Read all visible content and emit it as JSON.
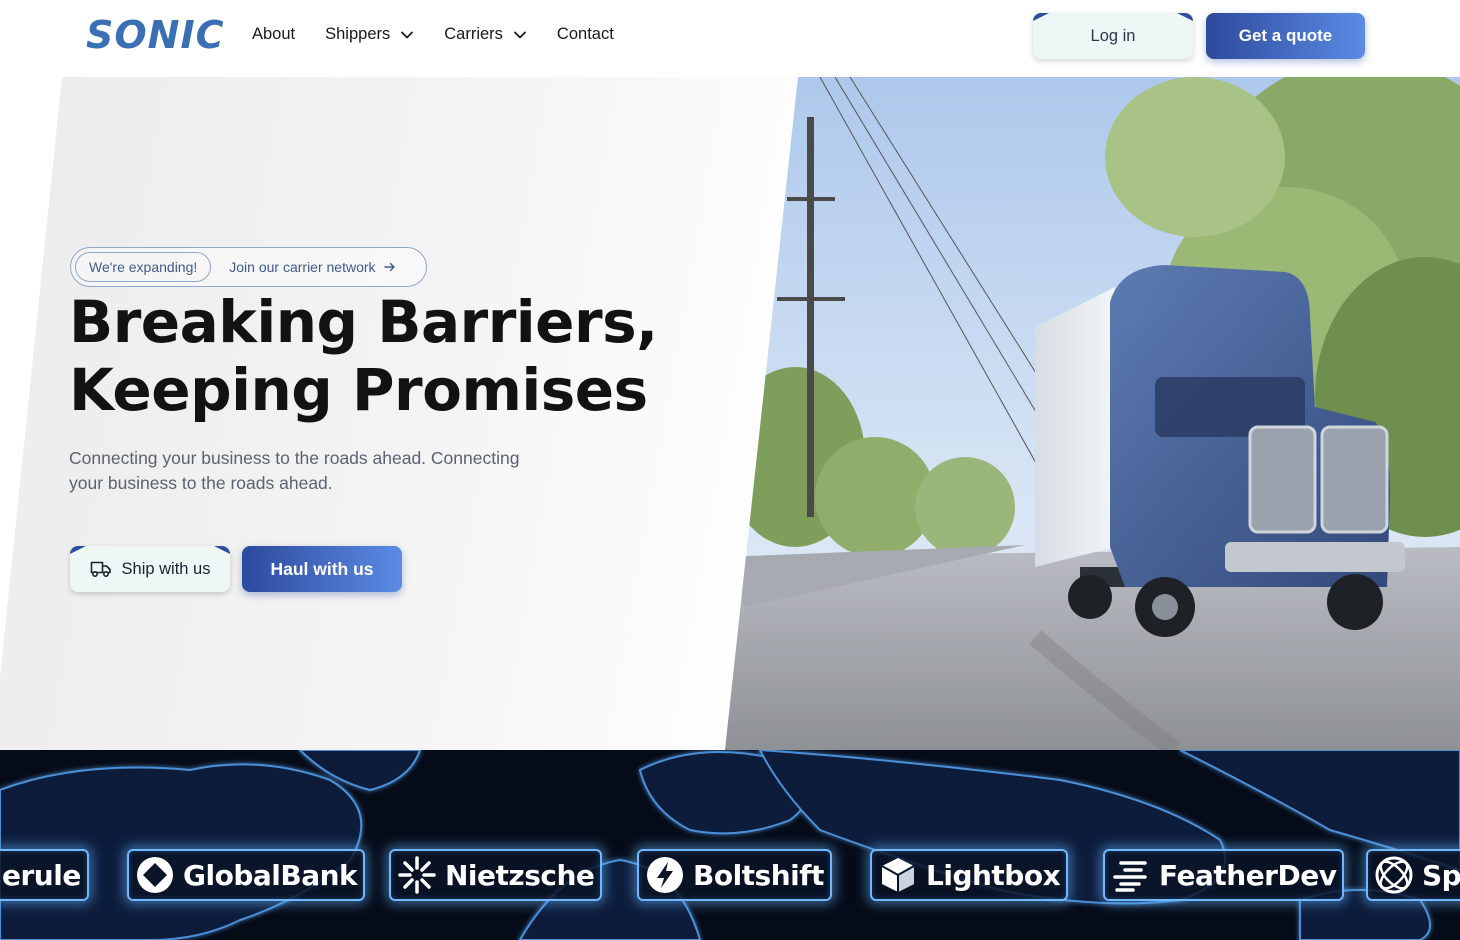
{
  "brand": {
    "name": "SONIC",
    "color": "#3b6fb3"
  },
  "nav": {
    "links": [
      {
        "label": "About"
      },
      {
        "label": "Shippers"
      },
      {
        "label": "Carriers"
      },
      {
        "label": "Contact"
      }
    ],
    "login_label": "Log in",
    "quote_label": "Get a quote"
  },
  "hero": {
    "badge": "We're expanding!",
    "badge_link": "Join our carrier network",
    "headline_line1": "Breaking Barriers,",
    "headline_line2": "Keeping Promises",
    "subtext": "Connecting your business to the roads ahead. Connecting your business to the roads ahead.",
    "ship_label": "Ship with us",
    "haul_label": "Haul with us"
  },
  "partners": [
    {
      "name": "erule",
      "icon": "none"
    },
    {
      "name": "GlobalBank",
      "icon": "globalbank-logo-icon"
    },
    {
      "name": "Nietzsche",
      "icon": "sunburst-icon"
    },
    {
      "name": "Boltshift",
      "icon": "bolt-icon"
    },
    {
      "name": "Lightbox",
      "icon": "cube-icon"
    },
    {
      "name": "FeatherDev",
      "icon": "feather-icon"
    },
    {
      "name": "Spl",
      "icon": "orbit-icon"
    }
  ],
  "colors": {
    "accent": "#2d4a9c",
    "accent_light": "#5b8be4",
    "glow": "#6fb8ff"
  }
}
